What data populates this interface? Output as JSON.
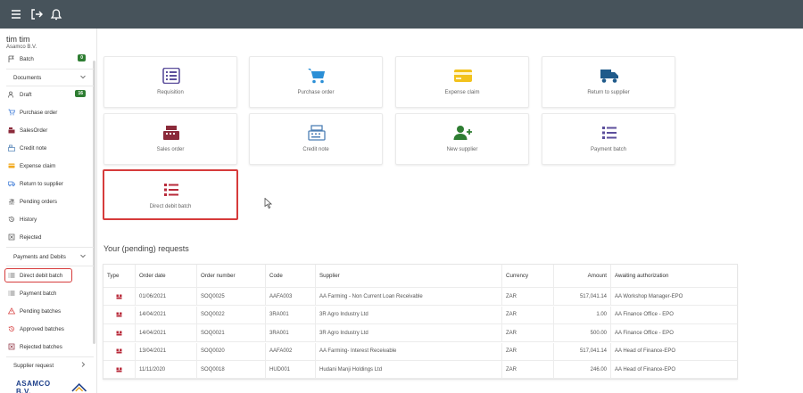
{
  "topbar": {
    "icons": [
      "menu-icon",
      "logout-icon",
      "bell-icon"
    ]
  },
  "user": {
    "name": "tim tim",
    "org": "Asamco B.V."
  },
  "sidebar": {
    "batch": {
      "label": "Batch",
      "badge": "0"
    },
    "documents_header": "Documents",
    "draft": {
      "label": "Draft",
      "badge": "16"
    },
    "items_docs": [
      "Purchase order",
      "SalesOrder",
      "Credit note",
      "Expense claim",
      "Return to supplier",
      "Pending orders",
      "History",
      "Rejected"
    ],
    "payments_header": "Payments and Debits",
    "items_pay": [
      "Direct debit batch",
      "Payment batch",
      "Pending batches",
      "Approved batches",
      "Rejected batches"
    ],
    "supplier_header": "Supplier request",
    "logo_text": "ASAMCO B.V."
  },
  "tiles": [
    "Requisition",
    "Purchase order",
    "Expense claim",
    "Return to supplier",
    "Sales order",
    "Credit note",
    "New supplier",
    "Payment batch",
    "Direct debit batch"
  ],
  "requests": {
    "title": "Your (pending) requests",
    "columns": [
      "Type",
      "Order date",
      "Order number",
      "Code",
      "Supplier",
      "Currency",
      "Amount",
      "Awaiting authorization"
    ],
    "rows": [
      [
        "",
        "01/06/2021",
        "SOQ0025",
        "AAFA003",
        "AA Farming - Non Current Loan Receivable",
        "ZAR",
        "517,041.14",
        "AA Workshop Manager-EPO"
      ],
      [
        "",
        "14/04/2021",
        "SOQ0022",
        "3RA001",
        "3R Agro Industry Ltd",
        "ZAR",
        "1.00",
        "AA Finance Office - EPO"
      ],
      [
        "",
        "14/04/2021",
        "SOQ0021",
        "3RA001",
        "3R Agro Industry Ltd",
        "ZAR",
        "500.00",
        "AA Finance Office - EPO"
      ],
      [
        "",
        "13/04/2021",
        "SOQ0020",
        "AAFA002",
        "AA Farming- Interest Receivable",
        "ZAR",
        "517,041.14",
        "AA Head of Finance-EPO"
      ],
      [
        "",
        "11/11/2020",
        "SOQ0018",
        "HUD001",
        "Hudani Manji Holdings Ltd",
        "ZAR",
        "246.00",
        "AA Head of Finance-EPO"
      ]
    ]
  },
  "colors": {
    "topbar": "#47535b",
    "highlight": "#d63b3b",
    "badge": "#2e7d32",
    "accent_purple": "#5c4f9c"
  }
}
